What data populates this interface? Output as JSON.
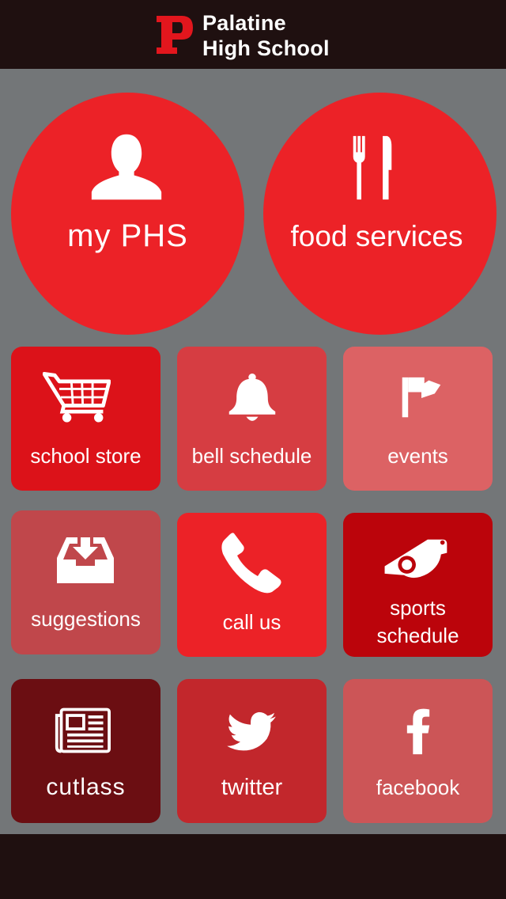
{
  "header": {
    "logo_letter": "P",
    "title_line1": "Palatine",
    "title_line2": "High School"
  },
  "circles": [
    {
      "label": "my PHS",
      "icon": "user-icon",
      "color": "#ec2227"
    },
    {
      "label": "food services",
      "icon": "fork-knife-icon",
      "color": "#ec2227"
    }
  ],
  "tiles": [
    {
      "label": "school store",
      "icon": "cart-icon",
      "color": "#dc1219"
    },
    {
      "label": "bell schedule",
      "icon": "bell-icon",
      "color": "#d63d42"
    },
    {
      "label": "events",
      "icon": "flag-icon",
      "color": "#dc6264"
    },
    {
      "label": "suggestions",
      "icon": "inbox-download-icon",
      "color": "#c0474b"
    },
    {
      "label": "call us",
      "icon": "phone-icon",
      "color": "#ec2227"
    },
    {
      "label_line1": "sports",
      "label_line2": "schedule",
      "icon": "whistle-icon",
      "color": "#bb040b"
    },
    {
      "label": "cutlass",
      "icon": "newspaper-icon",
      "color": "#6b0e12"
    },
    {
      "label": "twitter",
      "icon": "twitter-icon",
      "color": "#c2272c"
    },
    {
      "label": "facebook",
      "icon": "facebook-icon",
      "color": "#cc5557"
    }
  ]
}
